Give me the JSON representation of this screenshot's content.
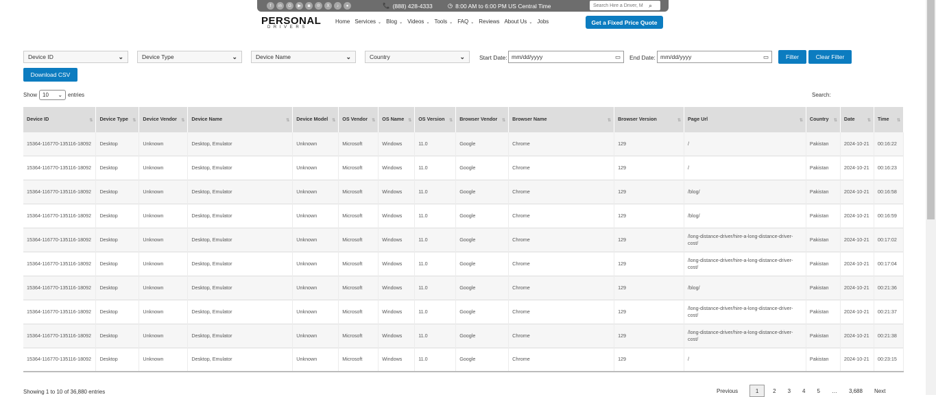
{
  "header": {
    "social_icons": [
      "facebook-icon",
      "linkedin-icon",
      "google-icon",
      "youtube-icon",
      "instagram-icon",
      "pinterest-icon",
      "x-icon",
      "tiktok-icon",
      "location-icon"
    ],
    "social_glyphs": [
      "f",
      "in",
      "G",
      "▶",
      "◙",
      "℗",
      "X",
      "♪",
      "●"
    ],
    "phone": "(888) 428-4333",
    "hours": "8:00 AM to 6:00 PM US Central Time",
    "search_placeholder": "Search Hire a Driver, M",
    "logo_line1": "PERSONAL",
    "logo_line2": "DRIVERS",
    "nav": [
      {
        "label": "Home",
        "caret": false
      },
      {
        "label": "Services",
        "caret": true
      },
      {
        "label": "Blog",
        "caret": true
      },
      {
        "label": "Videos",
        "caret": true
      },
      {
        "label": "Tools",
        "caret": true
      },
      {
        "label": "FAQ",
        "caret": true
      },
      {
        "label": "Reviews",
        "caret": false
      },
      {
        "label": "About Us",
        "caret": true
      },
      {
        "label": "Jobs",
        "caret": false
      }
    ],
    "quote_button": "Get a Fixed Price Quote"
  },
  "filters": {
    "device_id": "Device ID",
    "device_type": "Device Type",
    "device_name": "Device Name",
    "country": "Country",
    "start_label": "Start Date:",
    "start_value": "mm/dd/yyyy",
    "end_label": "End Date:",
    "end_value": "mm/dd/yyyy",
    "filter_button": "Filter",
    "clear_button": "Clear Filter",
    "download_button": "Download CSV"
  },
  "table_controls": {
    "show_label": "Show",
    "show_value": "10",
    "entries_label": "entries",
    "search_label": "Search:"
  },
  "table": {
    "columns": [
      "Device ID",
      "Device Type",
      "Device Vendor",
      "Device Name",
      "Device Model",
      "OS Vendor",
      "OS Name",
      "OS Version",
      "Browser Vendor",
      "Browser Name",
      "Browser Version",
      "Page Url",
      "Country",
      "Date",
      "Time"
    ],
    "rows": [
      [
        "15364-116770-135116-18092",
        "Desktop",
        "Unknown",
        "Desktop, Emulator",
        "Unknown",
        "Microsoft",
        "Windows",
        "11.0",
        "Google",
        "Chrome",
        "129",
        "/",
        "Pakistan",
        "2024-10-21",
        "00:16:22"
      ],
      [
        "15364-116770-135116-18092",
        "Desktop",
        "Unknown",
        "Desktop, Emulator",
        "Unknown",
        "Microsoft",
        "Windows",
        "11.0",
        "Google",
        "Chrome",
        "129",
        "/",
        "Pakistan",
        "2024-10-21",
        "00:16:23"
      ],
      [
        "15364-116770-135116-18092",
        "Desktop",
        "Unknown",
        "Desktop, Emulator",
        "Unknown",
        "Microsoft",
        "Windows",
        "11.0",
        "Google",
        "Chrome",
        "129",
        "/blog/",
        "Pakistan",
        "2024-10-21",
        "00:16:58"
      ],
      [
        "15364-116770-135116-18092",
        "Desktop",
        "Unknown",
        "Desktop, Emulator",
        "Unknown",
        "Microsoft",
        "Windows",
        "11.0",
        "Google",
        "Chrome",
        "129",
        "/blog/",
        "Pakistan",
        "2024-10-21",
        "00:16:59"
      ],
      [
        "15364-116770-135116-18092",
        "Desktop",
        "Unknown",
        "Desktop, Emulator",
        "Unknown",
        "Microsoft",
        "Windows",
        "11.0",
        "Google",
        "Chrome",
        "129",
        "/long-distance-driver/hire-a-long-distance-driver-cost/",
        "Pakistan",
        "2024-10-21",
        "00:17:02"
      ],
      [
        "15364-116770-135116-18092",
        "Desktop",
        "Unknown",
        "Desktop, Emulator",
        "Unknown",
        "Microsoft",
        "Windows",
        "11.0",
        "Google",
        "Chrome",
        "129",
        "/long-distance-driver/hire-a-long-distance-driver-cost/",
        "Pakistan",
        "2024-10-21",
        "00:17:04"
      ],
      [
        "15364-116770-135116-18092",
        "Desktop",
        "Unknown",
        "Desktop, Emulator",
        "Unknown",
        "Microsoft",
        "Windows",
        "11.0",
        "Google",
        "Chrome",
        "129",
        "/blog/",
        "Pakistan",
        "2024-10-21",
        "00:21:36"
      ],
      [
        "15364-116770-135116-18092",
        "Desktop",
        "Unknown",
        "Desktop, Emulator",
        "Unknown",
        "Microsoft",
        "Windows",
        "11.0",
        "Google",
        "Chrome",
        "129",
        "/long-distance-driver/hire-a-long-distance-driver-cost/",
        "Pakistan",
        "2024-10-21",
        "00:21:37"
      ],
      [
        "15364-116770-135116-18092",
        "Desktop",
        "Unknown",
        "Desktop, Emulator",
        "Unknown",
        "Microsoft",
        "Windows",
        "11.0",
        "Google",
        "Chrome",
        "129",
        "/long-distance-driver/hire-a-long-distance-driver-cost/",
        "Pakistan",
        "2024-10-21",
        "00:21:38"
      ],
      [
        "15364-116770-135116-18092",
        "Desktop",
        "Unknown",
        "Desktop, Emulator",
        "Unknown",
        "Microsoft",
        "Windows",
        "11.0",
        "Google",
        "Chrome",
        "129",
        "/",
        "Pakistan",
        "2024-10-21",
        "00:23:15"
      ]
    ]
  },
  "footer": {
    "info": "Showing 1 to 10 of 36,880 entries",
    "pager": [
      "Previous",
      "1",
      "2",
      "3",
      "4",
      "5",
      "…",
      "3,688",
      "Next"
    ]
  },
  "colors": {
    "accent": "#0c7cc0",
    "topbar": "#6d6d6d",
    "header_bg": "#dddddd"
  }
}
